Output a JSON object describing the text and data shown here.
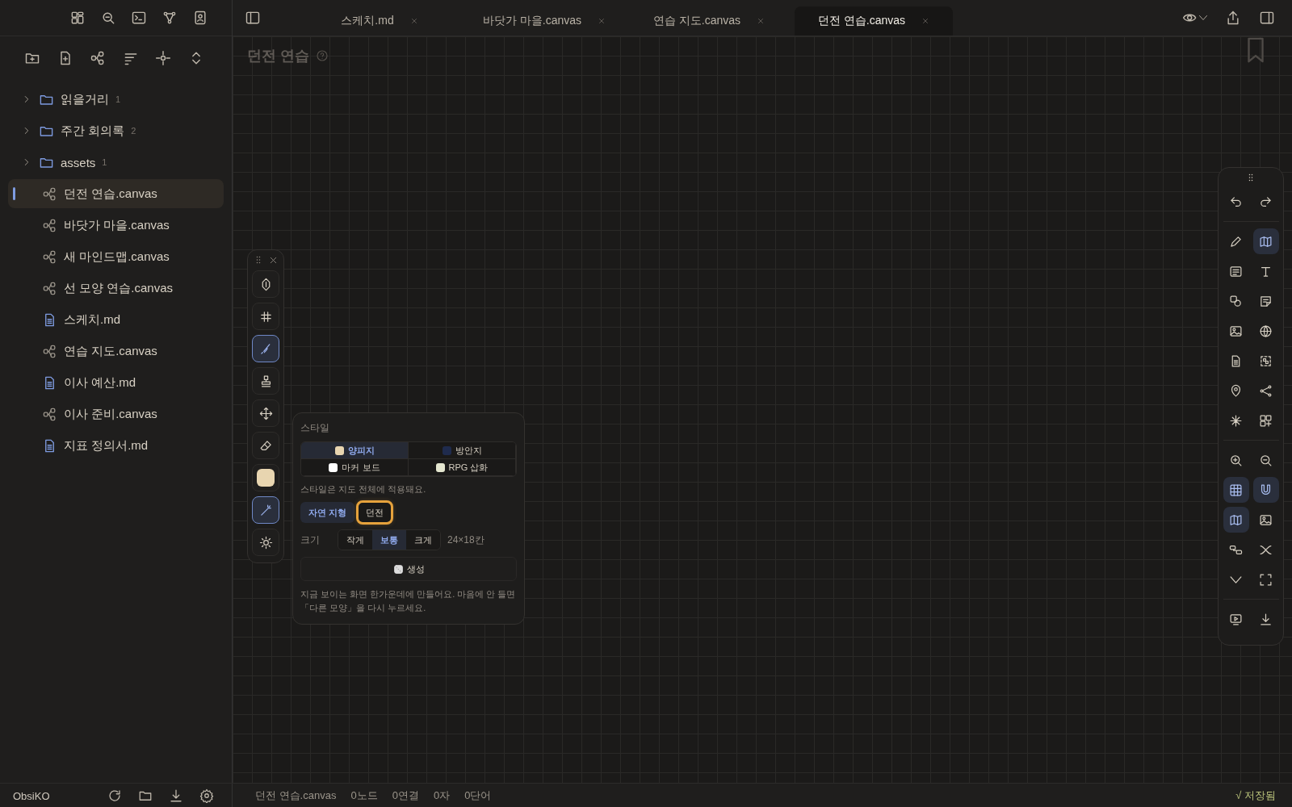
{
  "sidebar": {
    "header_buttons": [
      {
        "selected": false
      },
      {
        "selected": false
      },
      {
        "selected": false
      },
      {
        "selected": false
      },
      {
        "selected": false
      }
    ],
    "nav_buttons": [
      {
        "selected": false
      },
      {
        "selected": false
      },
      {
        "selected": false
      },
      {
        "selected": false
      },
      {
        "selected": false
      },
      {
        "selected": false
      }
    ],
    "tree": [
      {
        "kind": "folder",
        "name": "읽을거리",
        "count": "1",
        "expanded": false,
        "selected": false
      },
      {
        "kind": "folder",
        "name": "주간 회의록",
        "count": "2",
        "expanded": false,
        "selected": false
      },
      {
        "kind": "folder",
        "name": "assets",
        "count": "1",
        "expanded": false,
        "selected": false
      },
      {
        "kind": "canvas",
        "name": "던전 연습.canvas",
        "selected": true
      },
      {
        "kind": "canvas",
        "name": "바닷가 마을.canvas",
        "selected": false
      },
      {
        "kind": "canvas",
        "name": "새 마인드맵.canvas",
        "selected": false
      },
      {
        "kind": "canvas",
        "name": "선 모양 연습.canvas",
        "selected": false
      },
      {
        "kind": "md",
        "name": "스케치.md",
        "selected": false
      },
      {
        "kind": "canvas",
        "name": "연습 지도.canvas",
        "selected": false
      },
      {
        "kind": "md",
        "name": "이사 예산.md",
        "selected": false
      },
      {
        "kind": "canvas",
        "name": "이사 준비.canvas",
        "selected": false
      },
      {
        "kind": "md",
        "name": "지표 정의서.md",
        "selected": false
      }
    ],
    "vault_name": "ObsiKO"
  },
  "tabs": [
    {
      "label": "스케치.md",
      "selected": false
    },
    {
      "label": "바닷가 마을.canvas",
      "selected": false
    },
    {
      "label": "연습 지도.canvas",
      "selected": false
    },
    {
      "label": "던전 연습.canvas",
      "selected": true
    }
  ],
  "canvas": {
    "title": "던전 연습"
  },
  "palette": {
    "tools": [
      {
        "selected": false
      },
      {
        "selected": false
      },
      {
        "selected": true
      },
      {
        "selected": false
      },
      {
        "selected": false
      },
      {
        "selected": false
      },
      {
        "selected": false
      },
      {
        "selected": true
      },
      {
        "selected": false
      }
    ]
  },
  "map_popup": {
    "style_label": "스타일",
    "styles": [
      {
        "label": "양피지",
        "color": "#e8d5b0",
        "selected": true
      },
      {
        "label": "방안지",
        "color": "#1f2b4d",
        "selected": false
      },
      {
        "label": "마커 보드",
        "color": "#ffffff",
        "selected": false
      },
      {
        "label": "RPG 삽화",
        "color": "#e4e6cf",
        "selected": false
      }
    ],
    "style_note": "스타일은 지도 전체에 적용돼요.",
    "types": [
      {
        "label": "자연 지형",
        "selected": true,
        "highlighted": false
      },
      {
        "label": "던전",
        "selected": false,
        "highlighted": true
      }
    ],
    "size_label": "크기",
    "sizes": [
      {
        "label": "작게",
        "selected": false
      },
      {
        "label": "보통",
        "selected": true
      },
      {
        "label": "크게",
        "selected": false
      }
    ],
    "size_reading": "24×18칸",
    "generate_button": "생성",
    "hint": "지금 보이는 화면 한가운데에 만들어요. 마음에 안 들면 「다른 모양」을 다시 누르세요."
  },
  "right_toolbar": {
    "groups": [
      [
        {
          "selected": false
        },
        {
          "selected": false
        }
      ],
      [
        {
          "selected": false
        },
        {
          "selected": true
        },
        {
          "selected": false
        },
        {
          "selected": false
        },
        {
          "selected": false
        },
        {
          "selected": false
        },
        {
          "selected": false
        },
        {
          "selected": false
        },
        {
          "selected": false
        },
        {
          "selected": false
        },
        {
          "selected": false
        },
        {
          "selected": false
        },
        {
          "selected": false
        },
        {
          "selected": false
        }
      ],
      [
        {
          "selected": false
        },
        {
          "selected": false
        },
        {
          "selected": true
        },
        {
          "selected": true
        },
        {
          "selected": true
        },
        {
          "selected": false
        },
        {
          "selected": false
        },
        {
          "selected": false
        },
        {
          "selected": false
        },
        {
          "selected": false
        }
      ],
      [
        {
          "selected": false
        },
        {
          "selected": false
        }
      ]
    ]
  },
  "status_bar": {
    "items": [
      "던전 연습.canvas",
      "0노드",
      "0연결",
      "0자",
      "0단어"
    ],
    "saved": "√ 저장됨"
  }
}
